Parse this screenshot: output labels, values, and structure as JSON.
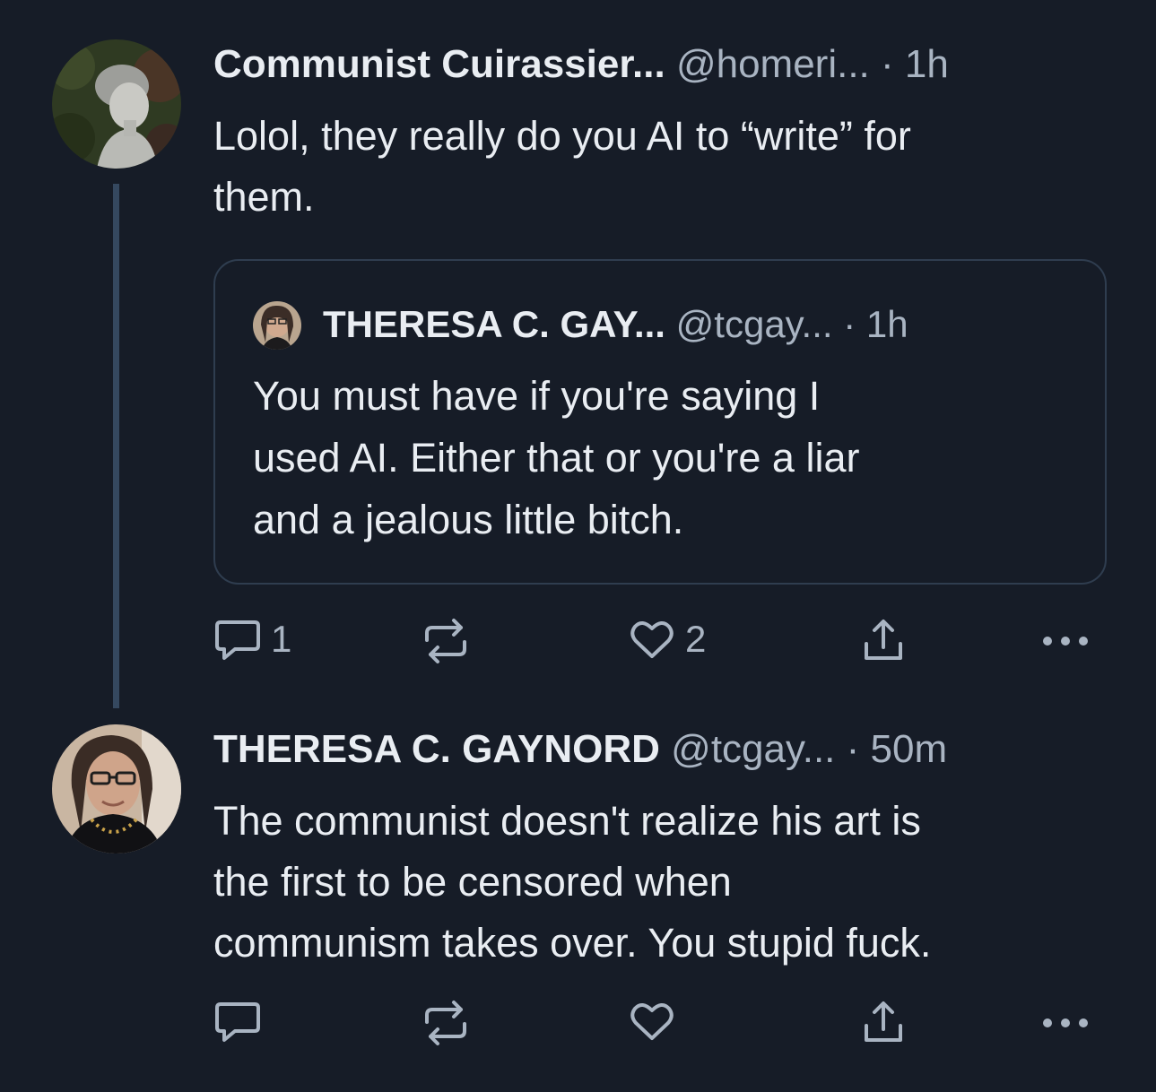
{
  "posts": [
    {
      "author_name": "Communist Cuirassier...",
      "handle": "@homeri...",
      "separator": "·",
      "time": "1h",
      "text_lines": [
        "Lolol, they really do you AI to “write” for",
        "them."
      ],
      "quote": {
        "author_name": "THERESA C. GAY...",
        "handle": "@tcgay...",
        "separator": "·",
        "time": "1h",
        "text_lines": [
          "You must have if you're saying I",
          "used AI. Either that or you're a liar",
          "and a jealous little bitch."
        ]
      },
      "actions": {
        "reply_icon": "reply-icon",
        "reply_count": "1",
        "repost_icon": "repost-icon",
        "like_icon": "heart-icon",
        "like_count": "2",
        "share_icon": "share-icon",
        "more_icon": "more-icon"
      }
    },
    {
      "author_name": "THERESA C. GAYNORD",
      "handle": "@tcgay...",
      "separator": "·",
      "time": "50m",
      "text_lines": [
        "The communist doesn't realize his art is",
        "the first to be  censored when",
        "communism takes over. You stupid fuck."
      ],
      "actions": {
        "reply_icon": "reply-icon",
        "repost_icon": "repost-icon",
        "like_icon": "heart-icon",
        "share_icon": "share-icon",
        "more_icon": "more-icon"
      }
    }
  ],
  "colors": {
    "background": "#161c27",
    "text": "#e9edf2",
    "muted": "#a9b4c2",
    "thread_line": "#35485f",
    "card_border": "#2f3d4f"
  }
}
